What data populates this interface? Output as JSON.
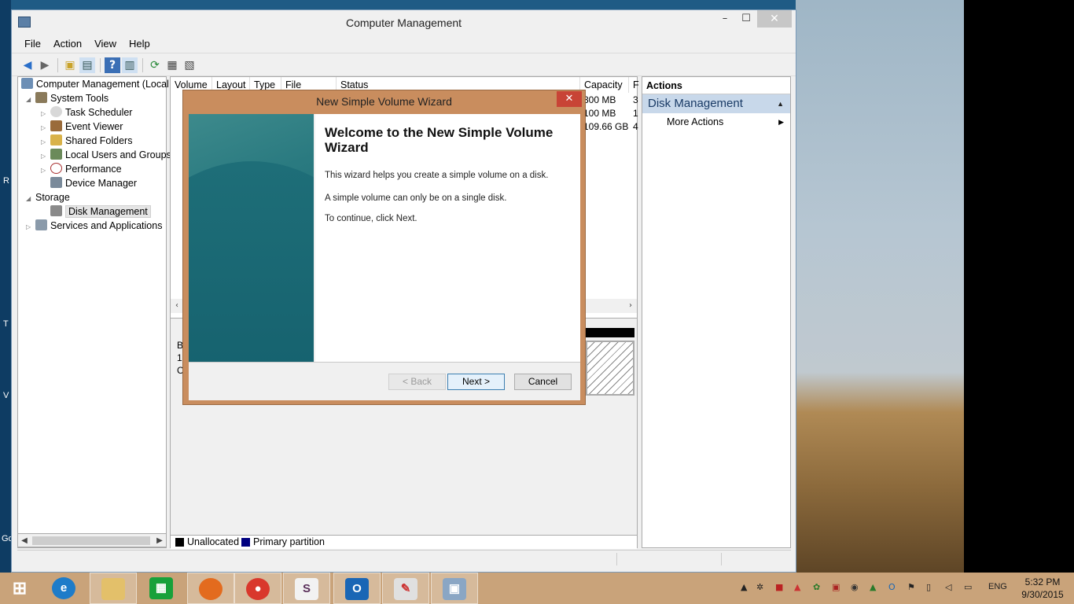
{
  "window": {
    "title": "Computer Management",
    "controls": {
      "minimize": "–",
      "maximize": "☐",
      "close": "✕"
    }
  },
  "menu": [
    "File",
    "Action",
    "View",
    "Help"
  ],
  "toolbar_icons": [
    "back-arrow-icon",
    "forward-arrow-icon",
    "up-folder-icon",
    "show-hide-console-tree-icon",
    "help-icon",
    "show-hide-action-pane-icon",
    "refresh-icon",
    "properties-icon",
    "export-list-icon"
  ],
  "tree": {
    "root": "Computer Management (Local",
    "items": [
      {
        "label": "System Tools",
        "level": 1,
        "expander": "◢"
      },
      {
        "label": "Task Scheduler",
        "level": 2,
        "expander": "▷"
      },
      {
        "label": "Event Viewer",
        "level": 2,
        "expander": "▷"
      },
      {
        "label": "Shared Folders",
        "level": 2,
        "expander": "▷"
      },
      {
        "label": "Local Users and Groups",
        "level": 2,
        "expander": "▷"
      },
      {
        "label": "Performance",
        "level": 2,
        "expander": "▷"
      },
      {
        "label": "Device Manager",
        "level": 2,
        "expander": ""
      },
      {
        "label": "Storage",
        "level": 1,
        "expander": "◢"
      },
      {
        "label": "Disk Management",
        "level": 2,
        "expander": "",
        "selected": true
      },
      {
        "label": "Services and Applications",
        "level": 1,
        "expander": "▷"
      }
    ]
  },
  "volume_list": {
    "columns": [
      "Volume",
      "Layout",
      "Type",
      "File System",
      "Status",
      "Capacity",
      "F"
    ],
    "capacity_values": [
      "300 MB",
      "100 MB",
      "109.66 GB"
    ],
    "free_values": [
      "3",
      "1",
      "4"
    ]
  },
  "disk_panel": {
    "partial_labels": [
      "B",
      "1",
      "C"
    ]
  },
  "legend": [
    {
      "label": "Unallocated",
      "color": "#000000"
    },
    {
      "label": "Primary partition",
      "color": "#000080"
    }
  ],
  "actions": {
    "header": "Actions",
    "group": "Disk Management",
    "items": [
      "More Actions"
    ]
  },
  "wizard": {
    "title": "New Simple Volume Wizard",
    "heading": "Welcome to the New Simple Volume Wizard",
    "paragraphs": [
      "This wizard helps you create a simple volume on a disk.",
      "A simple volume can only be on a single disk.",
      "To continue, click Next."
    ],
    "buttons": {
      "back": "< Back",
      "next": "Next >",
      "cancel": "Cancel"
    },
    "close": "✕"
  },
  "desktop_chars": [
    "R",
    "T",
    "V",
    "Go"
  ],
  "taskbar": {
    "pinned": [
      "windows-start-icon",
      "internet-explorer-icon",
      "file-explorer-icon",
      "store-icon",
      "firefox-icon",
      "chrome-icon",
      "slack-icon",
      "outlook-icon",
      "paint-icon",
      "computer-management-icon"
    ],
    "language": "ENG",
    "time": "5:32 PM",
    "date": "9/30/2015"
  }
}
